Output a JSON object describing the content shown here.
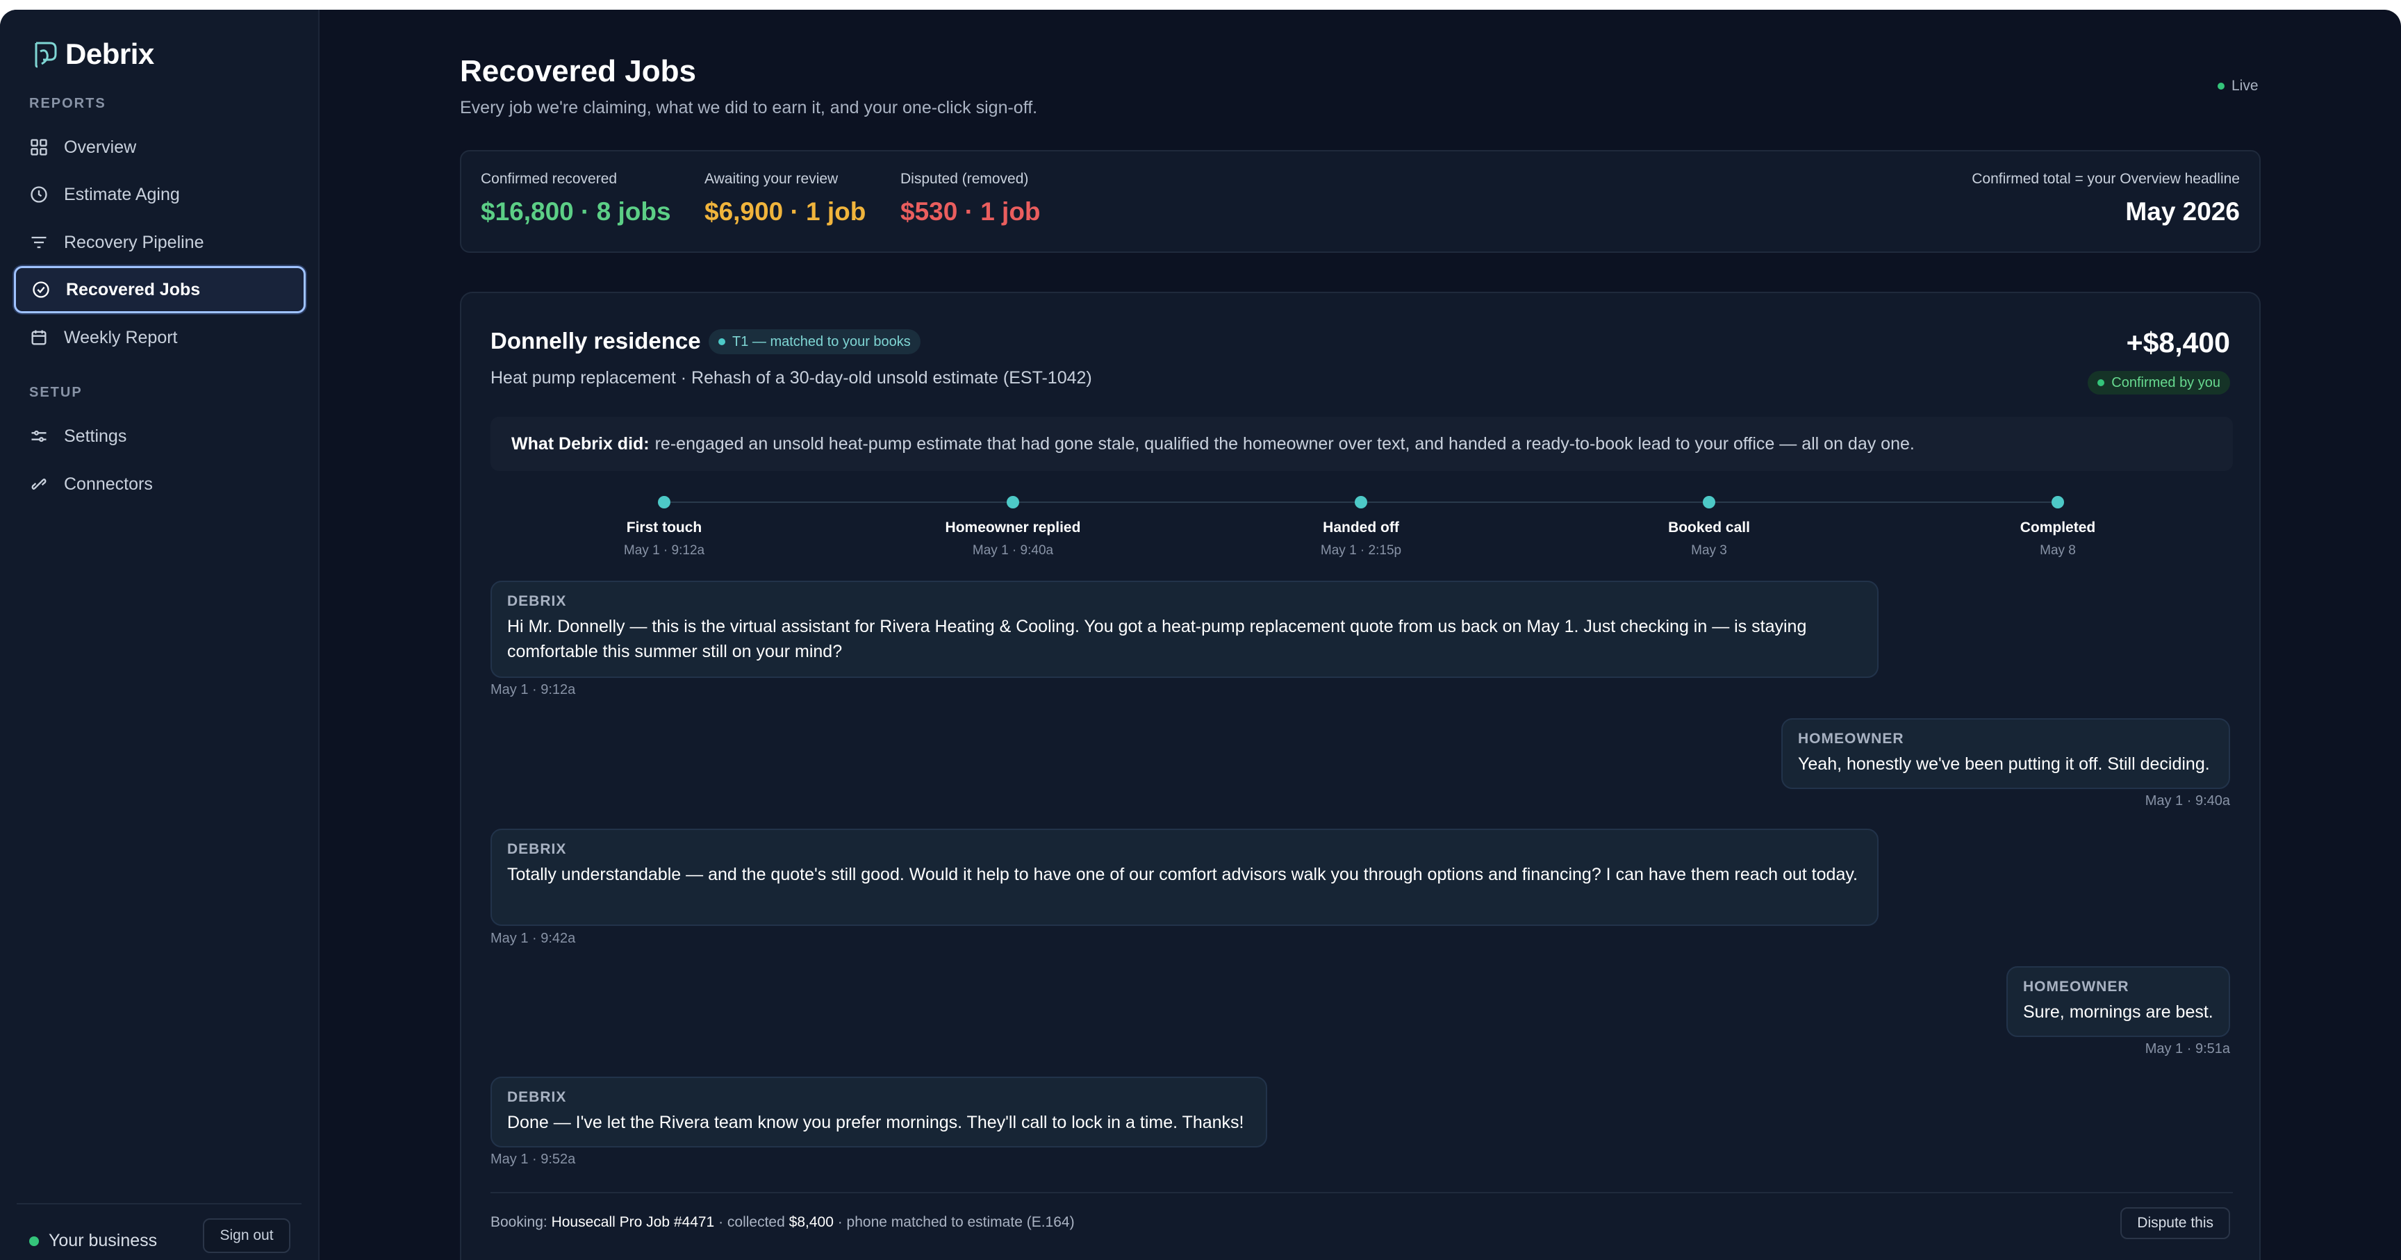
{
  "app": {
    "name": "Debrix"
  },
  "sidebar": {
    "reports_label": "REPORTS",
    "setup_label": "SETUP",
    "items": [
      {
        "label": "Overview",
        "icon": "grid-icon"
      },
      {
        "label": "Estimate Aging",
        "icon": "clock-icon"
      },
      {
        "label": "Recovery Pipeline",
        "icon": "filter-icon"
      },
      {
        "label": "Recovered Jobs",
        "icon": "check-circle-icon",
        "active": true
      },
      {
        "label": "Weekly Report",
        "icon": "calendar-icon"
      }
    ],
    "setup_items": [
      {
        "label": "Settings",
        "icon": "sliders-icon"
      },
      {
        "label": "Connectors",
        "icon": "link-icon"
      }
    ],
    "footer": {
      "business": "Your business",
      "sign_out": "Sign out"
    }
  },
  "header": {
    "title": "Recovered Jobs",
    "subtitle": "Every job we're claiming, what we did to earn it, and your one-click sign-off.",
    "live": "Live"
  },
  "stats": {
    "confirmed": {
      "label": "Confirmed recovered",
      "value": "$16,800 · 8 jobs",
      "color": "#5ccf86"
    },
    "awaiting": {
      "label": "Awaiting your review",
      "value": "$6,900 · 1 job",
      "color": "#f0b43c"
    },
    "disputed": {
      "label": "Disputed (removed)",
      "value": "$530 · 1 job",
      "color": "#ea5e5e"
    },
    "total": {
      "label": "Confirmed total = your Overview headline",
      "value": "May 2026"
    }
  },
  "job": {
    "title": "Donnelly residence",
    "tier_badge": "T1 — matched to your books",
    "subtitle": "Heat pump replacement · Rehash of a 30-day-old unsold estimate (EST-1042)",
    "amount": "+$8,400",
    "status": "Confirmed by you",
    "did_label": "What Debrix did:",
    "did_text": "re-engaged an unsold heat-pump estimate that had gone stale, qualified the homeowner over text, and handed a ready-to-book lead to your office — all on day one.",
    "timeline": [
      {
        "label": "First touch",
        "time": "May 1 · 9:12a"
      },
      {
        "label": "Homeowner replied",
        "time": "May 1 · 9:40a"
      },
      {
        "label": "Handed off",
        "time": "May 1 · 2:15p"
      },
      {
        "label": "Booked call",
        "time": "May 3"
      },
      {
        "label": "Completed",
        "time": "May 8"
      }
    ],
    "messages": [
      {
        "sender": "DEBRIX",
        "text": "Hi Mr. Donnelly — this is the virtual assistant for Rivera Heating & Cooling. You got a heat-pump replacement quote from us back on May 1. Just checking in — is staying comfortable this summer still on your mind?",
        "time": "May 1 · 9:12a"
      },
      {
        "sender": "HOMEOWNER",
        "text": "Yeah, honestly we've been putting it off. Still deciding.",
        "time": "May 1 · 9:40a"
      },
      {
        "sender": "DEBRIX",
        "text": "Totally understandable — and the quote's still good. Would it help to have one of our comfort advisors walk you through options and financing? I can have them reach out today.",
        "time": "May 1 · 9:42a"
      },
      {
        "sender": "HOMEOWNER",
        "text": "Sure, mornings are best.",
        "time": "May 1 · 9:51a"
      },
      {
        "sender": "DEBRIX",
        "text": "Done — I've let the Rivera team know you prefer mornings. They'll call to lock in a time. Thanks!",
        "time": "May 1 · 9:52a"
      }
    ],
    "booking": {
      "prefix": "Booking:",
      "job": "Housecall Pro Job #4471",
      "collected_prefix": "· collected",
      "collected": "$8,400",
      "suffix": "· phone matched to estimate (E.164)"
    },
    "dispute_label": "Dispute this"
  }
}
